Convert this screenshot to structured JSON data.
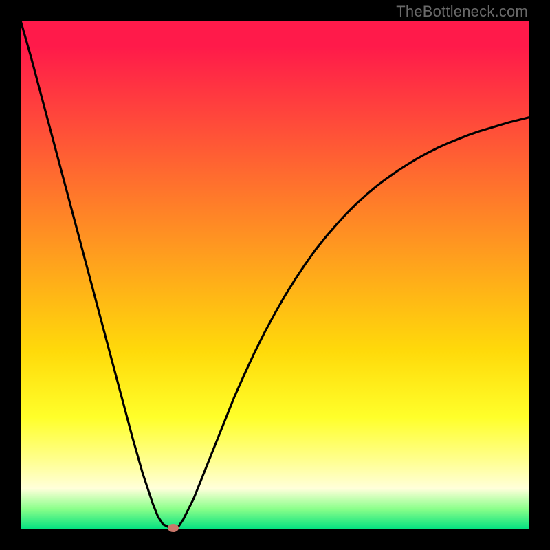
{
  "attribution": "TheBottleneck.com",
  "chart_data": {
    "type": "line",
    "title": "",
    "xlabel": "",
    "ylabel": "",
    "xlim": [
      0,
      100
    ],
    "ylim": [
      0,
      100
    ],
    "x": [
      0,
      2,
      4,
      6,
      8,
      10,
      12,
      14,
      16,
      18,
      20,
      22,
      24,
      26,
      27,
      28,
      29,
      30,
      31,
      32,
      34,
      36,
      38,
      40,
      42,
      44,
      46,
      48,
      50,
      52,
      54,
      56,
      58,
      60,
      62,
      64,
      66,
      68,
      70,
      72,
      74,
      76,
      78,
      80,
      82,
      84,
      86,
      88,
      90,
      92,
      94,
      96,
      98,
      100
    ],
    "y": [
      100,
      93,
      85.5,
      78,
      70.5,
      63,
      55.5,
      48,
      40.5,
      33,
      25.5,
      18,
      11,
      5,
      2.5,
      1,
      0.5,
      0,
      0.5,
      2,
      6,
      11,
      16,
      21,
      26,
      30.5,
      34.8,
      38.8,
      42.5,
      46,
      49.2,
      52.2,
      55,
      57.5,
      59.8,
      62,
      64,
      65.8,
      67.5,
      69,
      70.4,
      71.7,
      72.9,
      74,
      75,
      75.9,
      76.7,
      77.5,
      78.2,
      78.8,
      79.4,
      80,
      80.5,
      81
    ],
    "marker": {
      "x": 30,
      "y": 0
    },
    "background": {
      "type": "vertical-gradient",
      "stops": [
        {
          "pos": 0,
          "color": "#ff1a4a"
        },
        {
          "pos": 35,
          "color": "#ff7a2a"
        },
        {
          "pos": 65,
          "color": "#ffda0a"
        },
        {
          "pos": 92,
          "color": "#ffffda"
        },
        {
          "pos": 100,
          "color": "#00e080"
        }
      ]
    }
  }
}
